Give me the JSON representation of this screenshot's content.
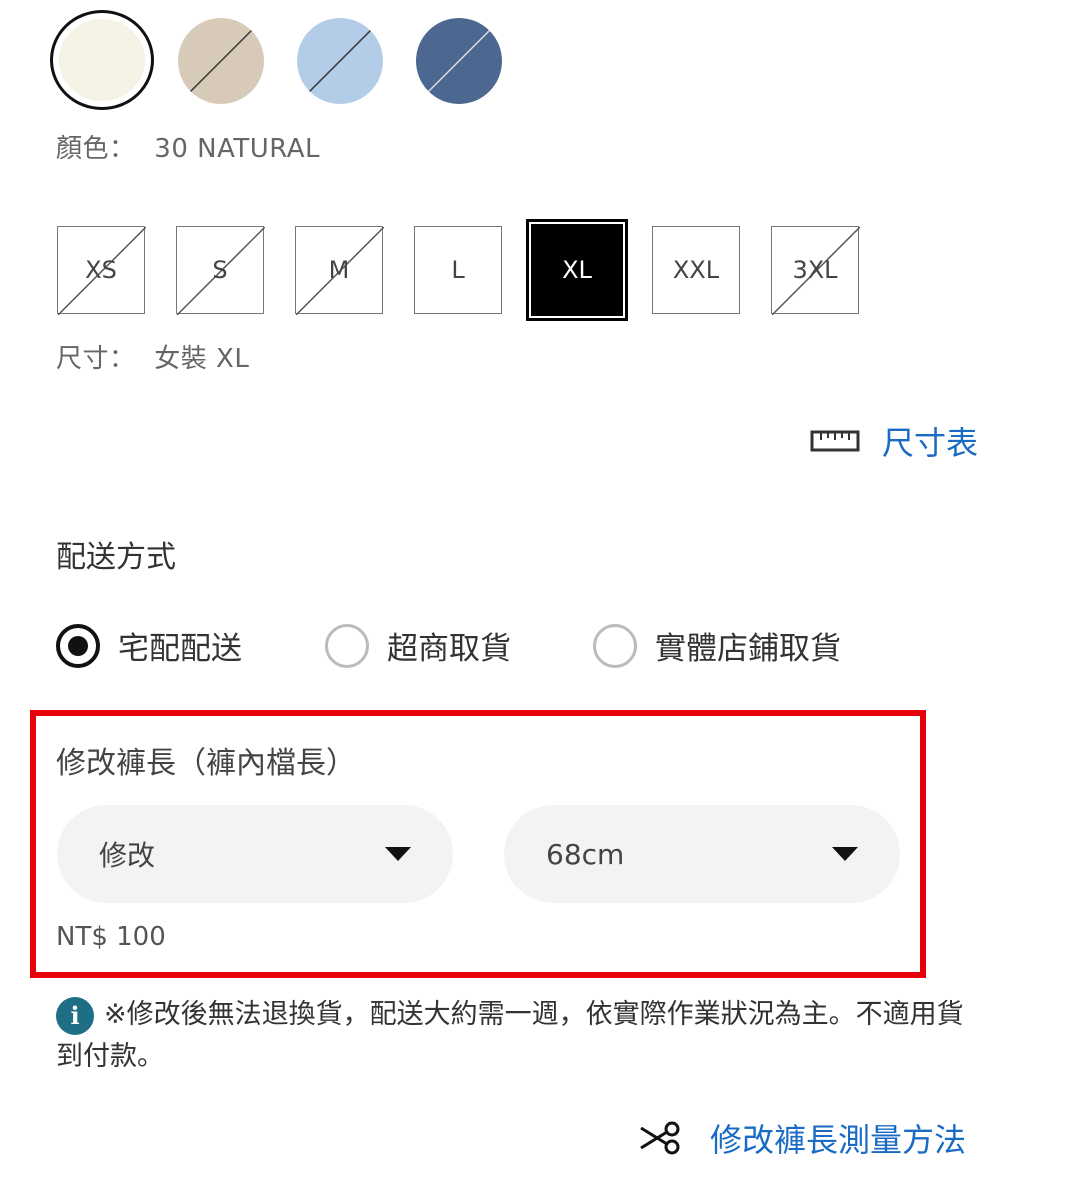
{
  "color": {
    "label": "顏色：",
    "selected_value": "30 NATURAL",
    "swatches": [
      {
        "name": "natural",
        "hex": "#f5f2e6",
        "available": true,
        "selected": true
      },
      {
        "name": "beige",
        "hex": "#d8cab8",
        "available": false,
        "selected": false
      },
      {
        "name": "light-blue",
        "hex": "#b3cde8",
        "available": false,
        "selected": false
      },
      {
        "name": "denim-blue",
        "hex": "#4d6890",
        "available": false,
        "selected": false
      }
    ]
  },
  "size": {
    "label": "尺寸：",
    "selected_value": "女裝 XL",
    "options": [
      {
        "label": "XS",
        "available": false,
        "selected": false
      },
      {
        "label": "S",
        "available": false,
        "selected": false
      },
      {
        "label": "M",
        "available": false,
        "selected": false
      },
      {
        "label": "L",
        "available": true,
        "selected": false
      },
      {
        "label": "XL",
        "available": true,
        "selected": true
      },
      {
        "label": "XXL",
        "available": true,
        "selected": false
      },
      {
        "label": "3XL",
        "available": false,
        "selected": false
      }
    ],
    "chart_link": "尺寸表",
    "chart_icon": "ruler-icon"
  },
  "delivery": {
    "title": "配送方式",
    "options": [
      {
        "label": "宅配配送",
        "selected": true
      },
      {
        "label": "超商取貨",
        "selected": false
      },
      {
        "label": "實體店鋪取貨",
        "selected": false
      }
    ]
  },
  "hemming": {
    "title": "修改褲長（褲內檔長）",
    "mode_select": "修改",
    "length_select": "68cm",
    "price": "NT$ 100"
  },
  "notice": {
    "icon": "info-icon",
    "text": "※修改後無法退換貨，配送大約需一週，依實際作業狀況為主。不適用貨到付款。"
  },
  "measure_link": {
    "icon": "scissors-icon",
    "label": "修改褲長測量方法"
  },
  "colors": {
    "link_blue": "#1a6bc4",
    "highlight_red": "#e8000b",
    "info_teal": "#1e6e86"
  }
}
